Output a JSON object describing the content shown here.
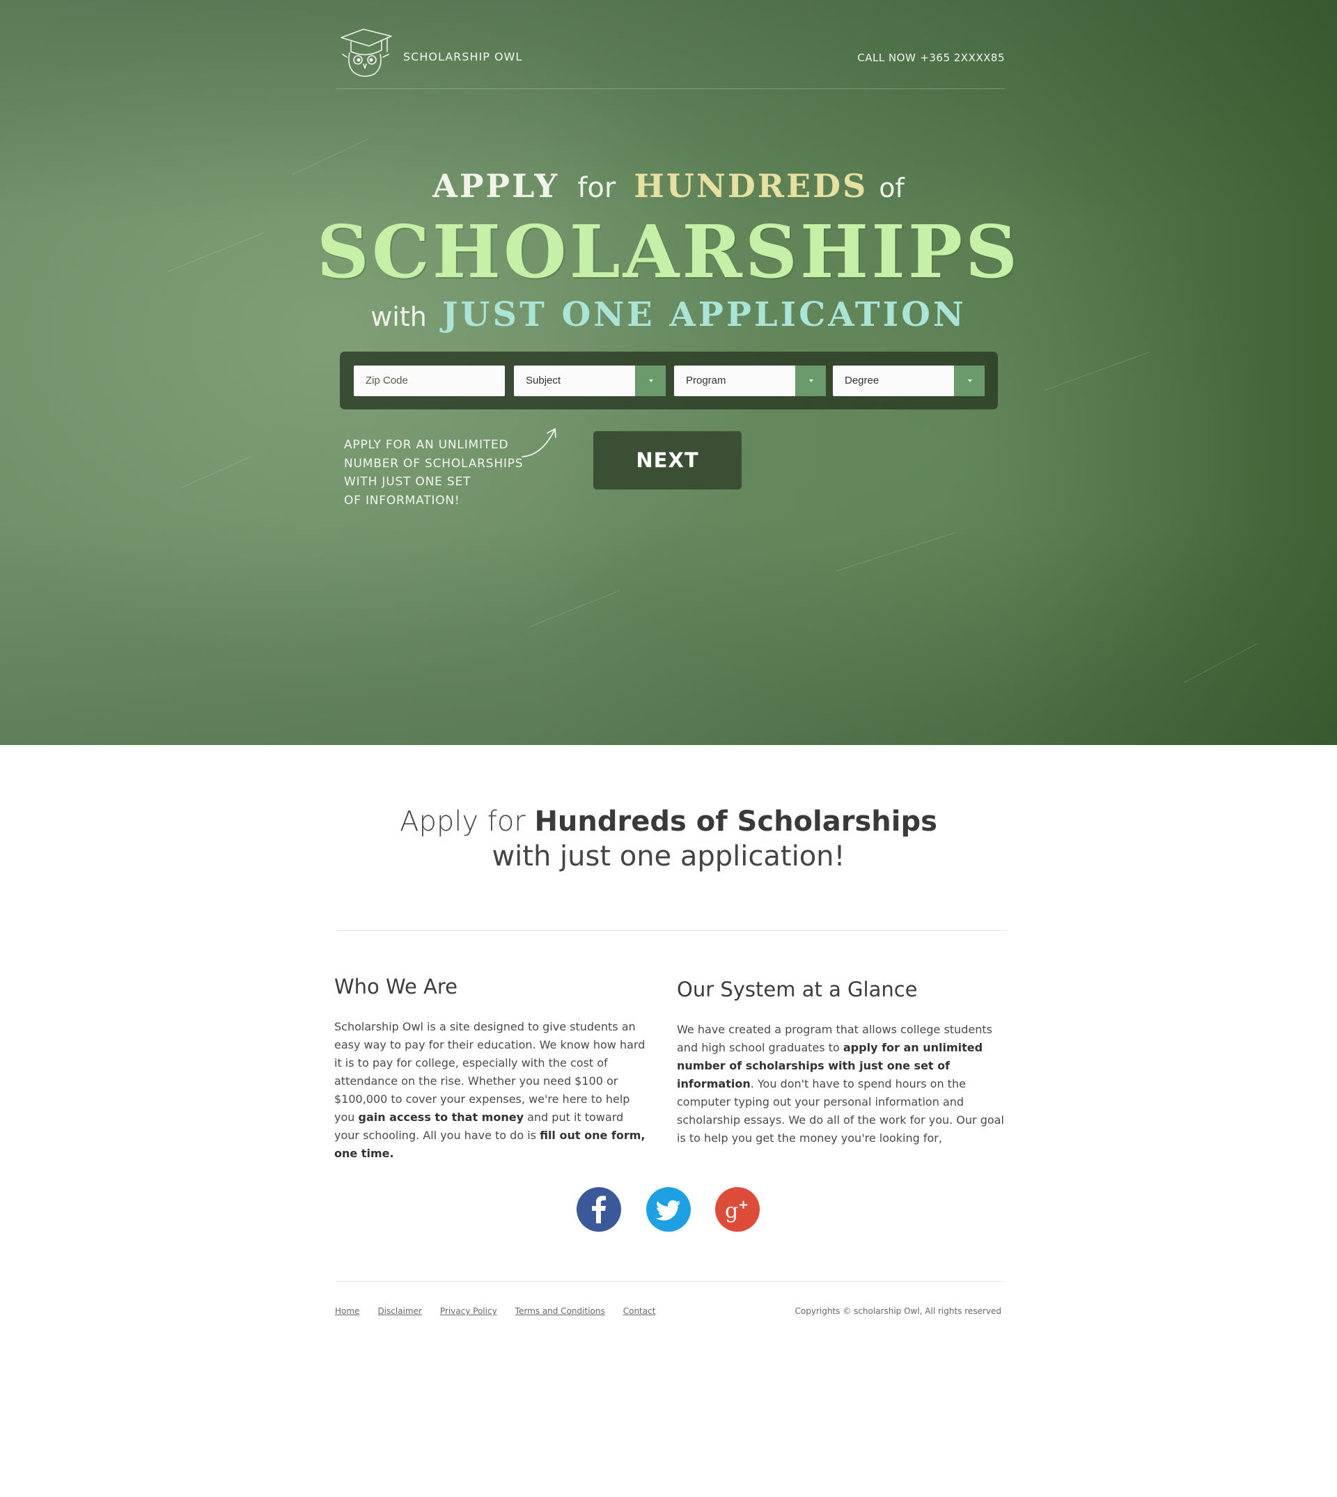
{
  "header": {
    "brand": "SCHOLARSHIP OWL",
    "call_label": "CALL NOW",
    "phone": "+365 2XXXX85"
  },
  "hero": {
    "line1": {
      "w1": "APPLY",
      "w2": "for",
      "w3": "HUNDREDS",
      "w4": "of"
    },
    "line2": "SCHOLARSHIPS",
    "line3": {
      "w1": "with",
      "w2": "JUST ONE APPLICATION"
    },
    "form": {
      "zip_placeholder": "Zip Code",
      "subject": "Subject",
      "program": "Program",
      "degree": "Degree"
    },
    "note": [
      "APPLY FOR AN UNLIMITED",
      "NUMBER OF SCHOLARSHIPS",
      "WITH JUST ONE SET",
      "OF INFORMATION!"
    ],
    "next_label": "NEXT"
  },
  "intro": {
    "prefix": "Apply for ",
    "bold": "Hundreds of Scholarships",
    "line2": "with just one application!"
  },
  "who": {
    "title": "Who We Are",
    "p1": "Scholarship Owl is a site designed to give students an easy way to pay for their education. We know how hard it is to pay for college, especially with the cost of attendance on the rise. Whether you need $100 or $100,000 to cover your expenses, we're here to help you ",
    "b1": "gain access to that money",
    "p2": " and put it toward your schooling. All you have to do is ",
    "b2": "fill out one form, one time."
  },
  "system": {
    "title": "Our System at a Glance",
    "p1": "We have created a program that allows college students and high school graduates to ",
    "b1": "apply for an unlimited number of scholarships with just one set of information",
    "p2": ". You don't have to spend hours on the computer typing out your personal information and scholarship essays. We do all of the work for you. Our goal is to help you get the money you're looking for,"
  },
  "social": [
    {
      "name": "facebook-icon",
      "color": "#3b5998"
    },
    {
      "name": "twitter-icon",
      "color": "#1da1e2"
    },
    {
      "name": "google-plus-icon",
      "color": "#dd4b39"
    }
  ],
  "footer": {
    "links": [
      "Home",
      "Disclaimer",
      "Privacy Policy",
      "Terms and Conditions",
      "Contact"
    ],
    "copyright": "Copyrights © scholarship Owl, All rights reserved"
  }
}
